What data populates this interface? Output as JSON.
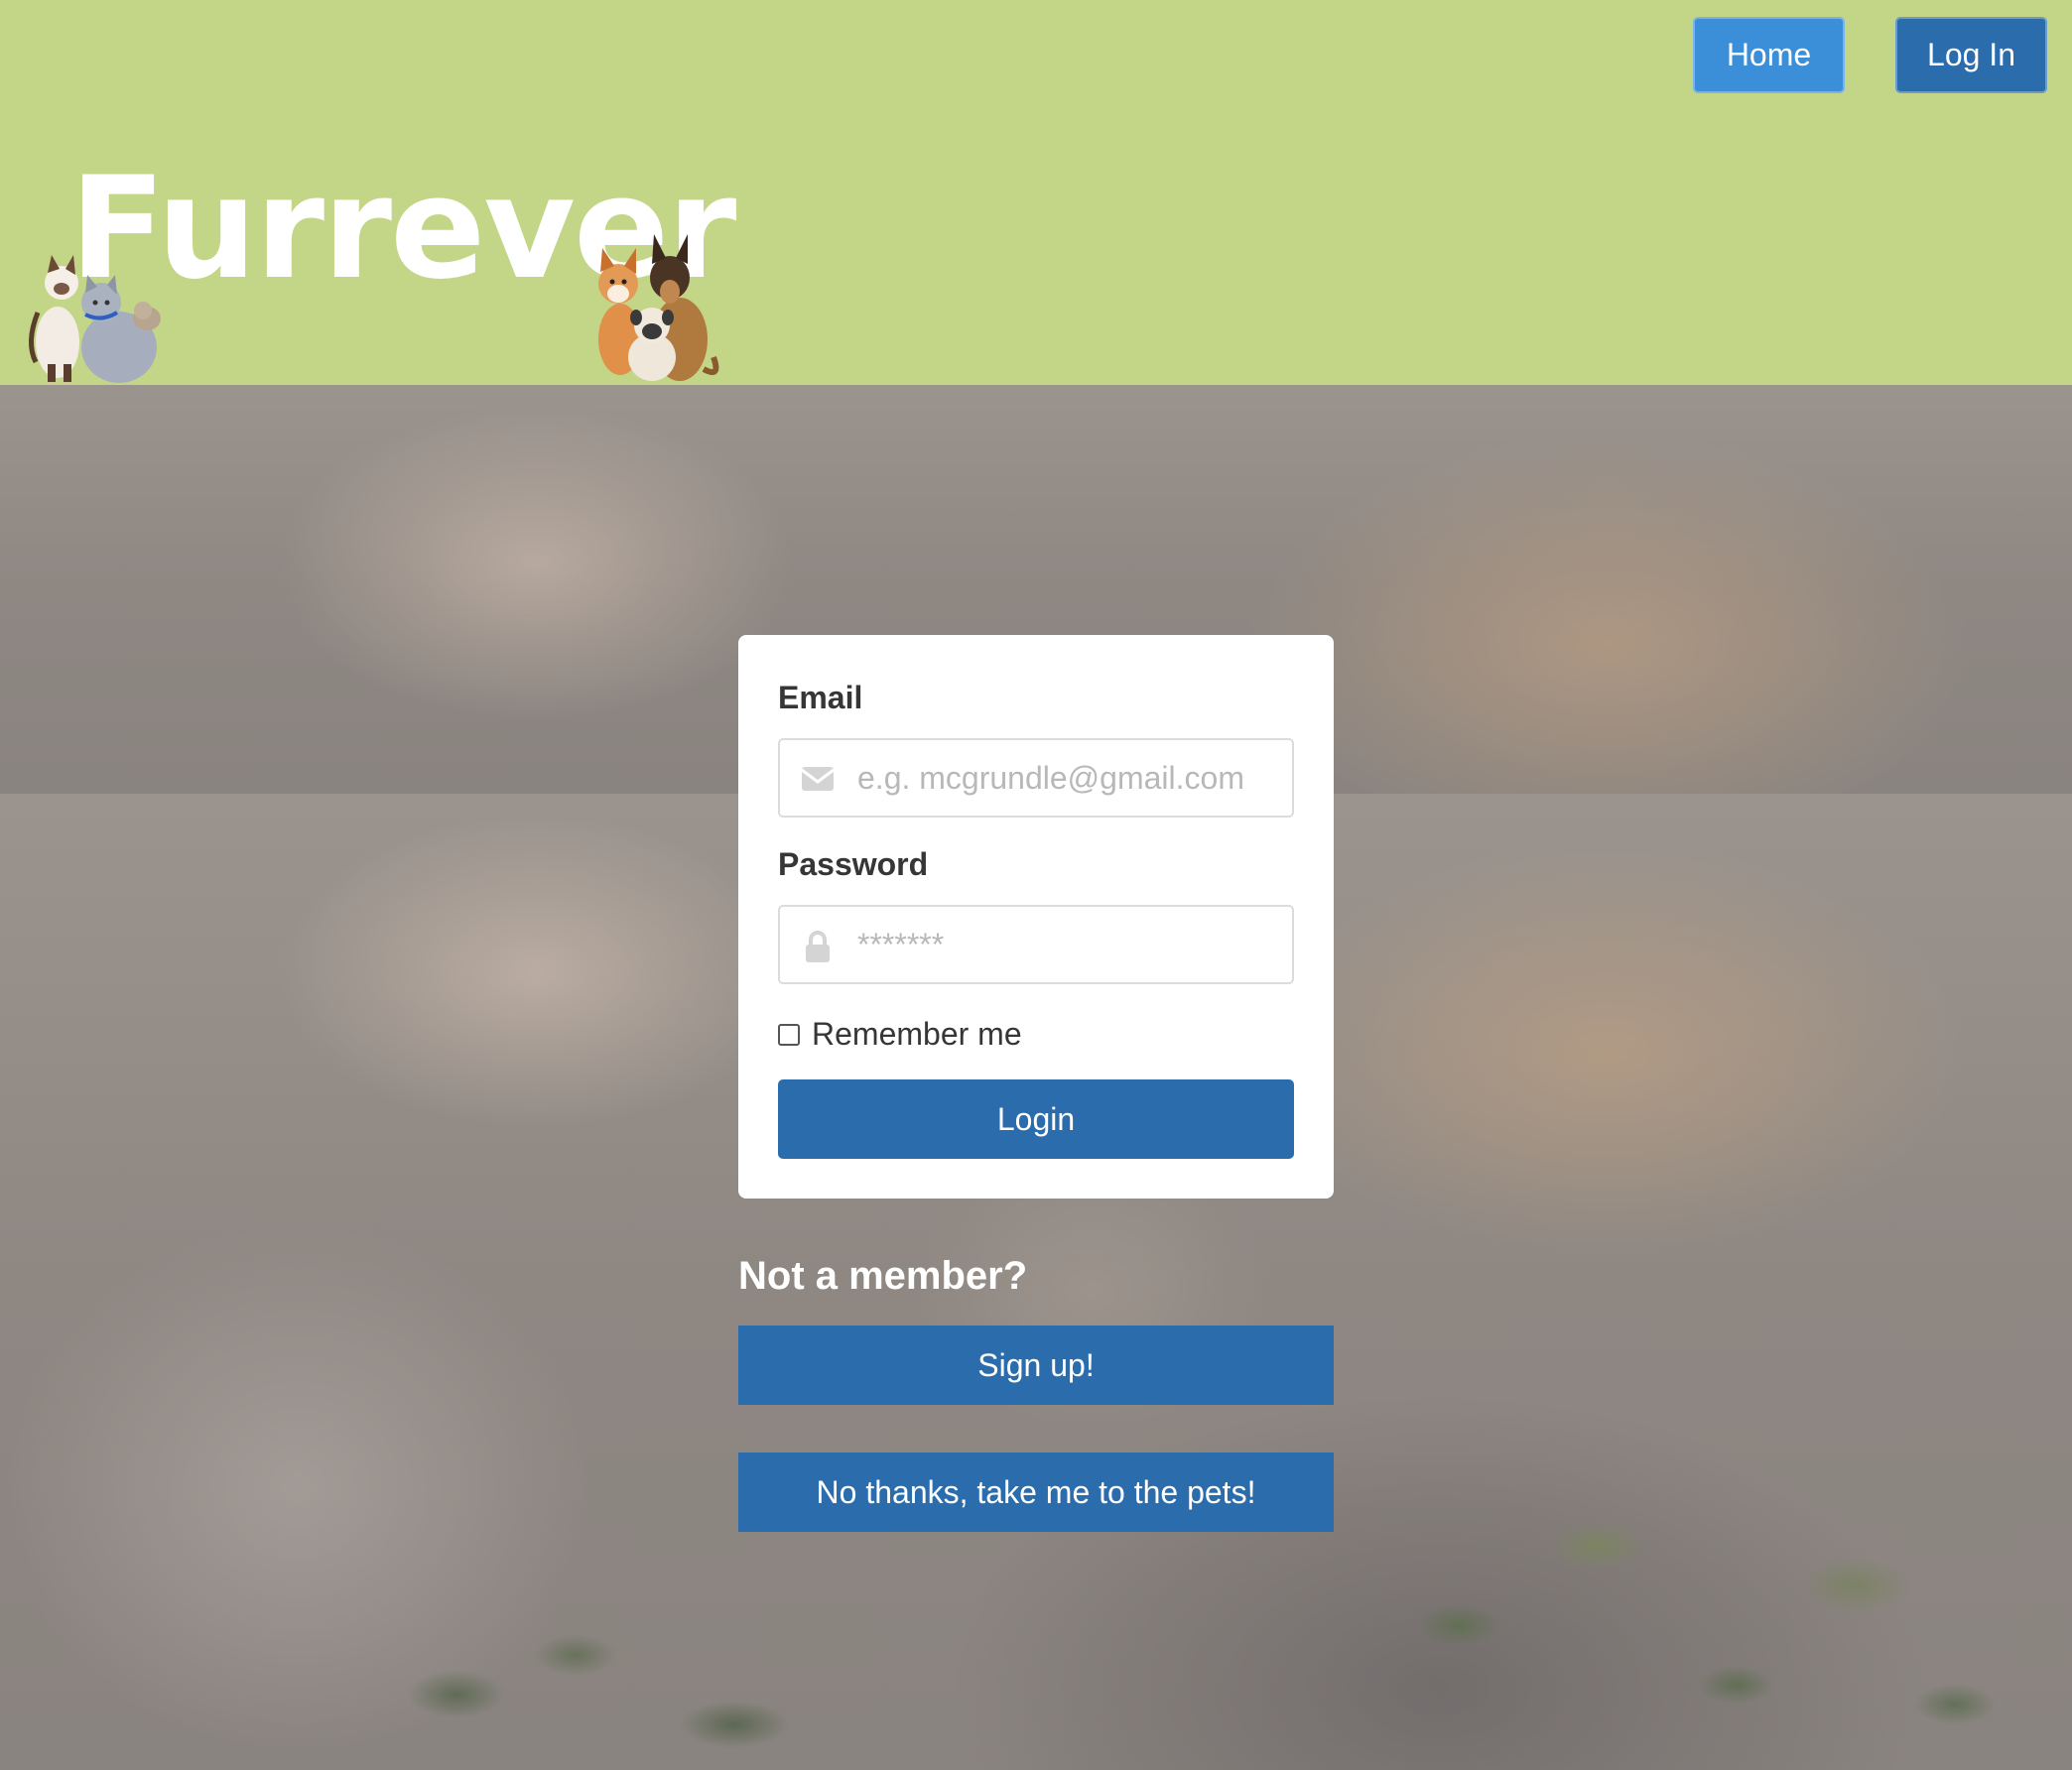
{
  "nav": {
    "home_label": "Home",
    "login_label": "Log In"
  },
  "brand": {
    "logo_text": "Furrever"
  },
  "login_form": {
    "email_label": "Email",
    "email_placeholder": "e.g. mcgrundle@gmail.com",
    "password_label": "Password",
    "password_placeholder": "*******",
    "remember_label": "Remember me",
    "remember_checked": false,
    "submit_label": "Login"
  },
  "signup": {
    "prompt": "Not a member?",
    "signup_label": "Sign up!",
    "skip_label": "No thanks, take me to the pets!"
  },
  "colors": {
    "header_bg": "#c3d687",
    "primary_button": "#2a6cac",
    "home_button": "#3b8fd9"
  }
}
